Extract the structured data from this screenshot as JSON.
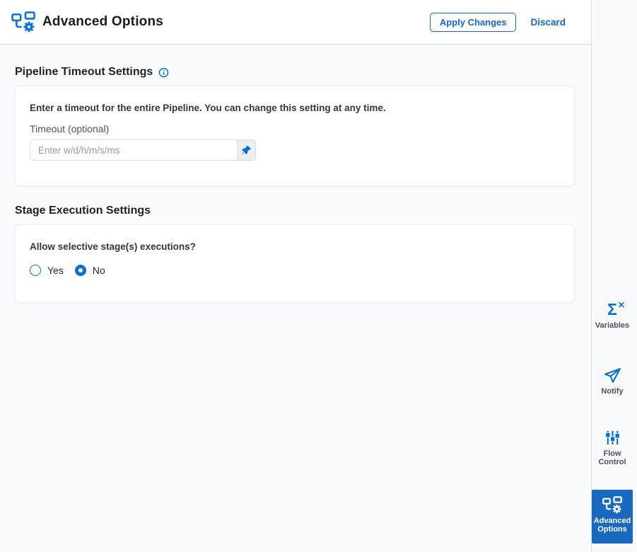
{
  "header": {
    "title": "Advanced Options",
    "apply_label": "Apply Changes",
    "discard_label": "Discard"
  },
  "sections": {
    "timeout": {
      "title": "Pipeline Timeout Settings",
      "info_icon": "info-icon",
      "description": "Enter a timeout for the entire Pipeline. You can change this setting at any time.",
      "field_label": "Timeout (optional)",
      "input_value": "",
      "input_placeholder": "Enter w/d/h/m/s/ms",
      "pin_icon": "pin-icon"
    },
    "stage": {
      "title": "Stage Execution Settings",
      "question": "Allow selective stage(s) executions?",
      "options": [
        {
          "label": "Yes",
          "selected": false
        },
        {
          "label": "No",
          "selected": true
        }
      ]
    }
  },
  "sidebar": {
    "items": [
      {
        "label": "Variables",
        "icon": "sigma-x-icon",
        "active": false
      },
      {
        "label": "Notify",
        "icon": "paper-plane-icon",
        "active": false
      },
      {
        "label": "Flow Control",
        "icon": "sliders-icon",
        "active": false
      },
      {
        "label": "Advanced Options",
        "icon": "pipeline-gear-icon",
        "active": true
      }
    ]
  },
  "colors": {
    "accent_blue": "#1766c8",
    "icon_blue": "#0a6fd2",
    "active_nav_bg": "#1a69c0",
    "radio_fill": "#0b6fd0",
    "content_bg": "#fafbff",
    "sidebar_bg": "#f8f9fa"
  }
}
